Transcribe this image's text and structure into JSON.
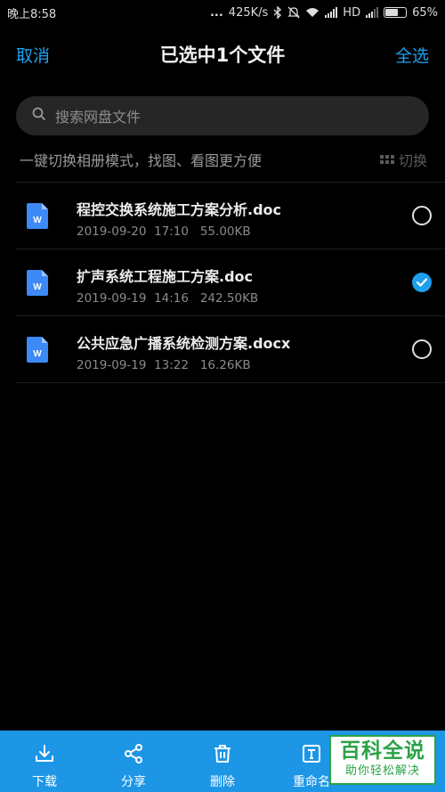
{
  "status_bar": {
    "time": "晚上8:58",
    "dots": "...",
    "speed": "425K/s",
    "network": "HD",
    "battery_percent": "65%",
    "battery_level": 0.65,
    "icons": [
      "bluetooth-icon",
      "mute-icon",
      "wifi-icon",
      "signal-icon",
      "signal-icon",
      "battery-icon"
    ]
  },
  "header": {
    "cancel_label": "取消",
    "title": "已选中1个文件",
    "select_all_label": "全选"
  },
  "search": {
    "placeholder": "搜索网盘文件"
  },
  "tip": {
    "text": "一键切换相册模式，找图、看图更方便",
    "switch_label": "切换"
  },
  "files": [
    {
      "name": "程控交换系统施工方案分析.doc",
      "date": "2019-09-20",
      "time": "17:10",
      "size": "55.00KB",
      "selected": false,
      "icon": "word-doc-icon"
    },
    {
      "name": "扩声系统工程施工方案.doc",
      "date": "2019-09-19",
      "time": "14:16",
      "size": "242.50KB",
      "selected": true,
      "icon": "word-doc-icon"
    },
    {
      "name": "公共应急广播系统检测方案.docx",
      "date": "2019-09-19",
      "time": "13:22",
      "size": "16.26KB",
      "selected": false,
      "icon": "word-doc-icon"
    }
  ],
  "toolbar": {
    "items": [
      {
        "label": "下载",
        "icon": "download-icon"
      },
      {
        "label": "分享",
        "icon": "share-icon"
      },
      {
        "label": "删除",
        "icon": "trash-icon"
      },
      {
        "label": "重命名",
        "icon": "rename-icon"
      },
      {
        "label": "",
        "icon": "more-icon"
      }
    ]
  },
  "watermark": {
    "main": "百科全说",
    "sub": "助你轻松解决"
  },
  "colors": {
    "accent": "#1fa0ee",
    "bottom_bar": "#1d96e6",
    "background": "#000000",
    "doc_icon": "#3d8af7",
    "watermark": "#2aa347"
  }
}
